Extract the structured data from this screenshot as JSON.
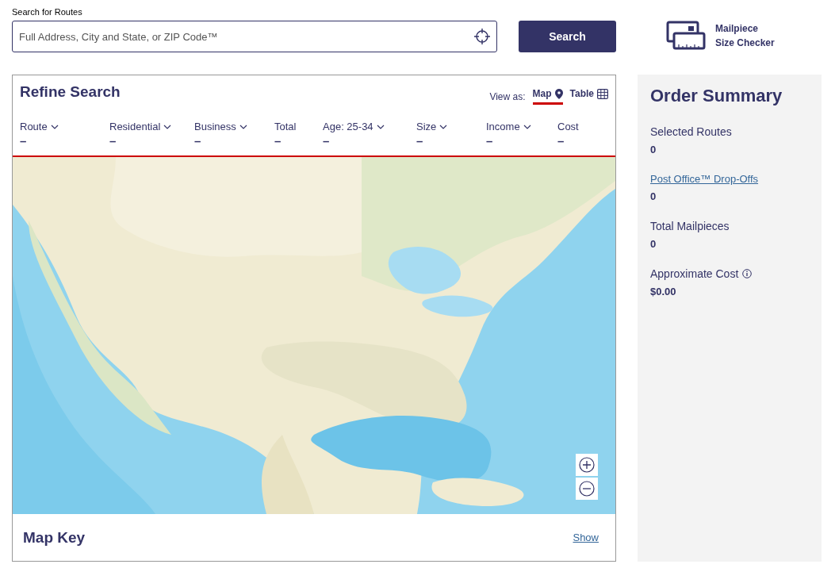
{
  "search": {
    "label": "Search for Routes",
    "placeholder": "Full Address, City and State, or ZIP Code™",
    "button": "Search"
  },
  "size_checker": {
    "line1": "Mailpiece",
    "line2": "Size Checker"
  },
  "refine": {
    "title": "Refine Search",
    "view_label": "View as:",
    "views": [
      {
        "label": "Map",
        "kind": "map",
        "selected": true
      },
      {
        "label": "Table",
        "kind": "table",
        "selected": false
      }
    ],
    "columns": [
      {
        "label": "Route",
        "dropdown": true,
        "value": "–"
      },
      {
        "label": "Residential",
        "dropdown": true,
        "value": "–"
      },
      {
        "label": "Business",
        "dropdown": true,
        "value": "–"
      },
      {
        "label": "Total",
        "dropdown": false,
        "value": "–"
      },
      {
        "label": "Age: 25-34",
        "dropdown": true,
        "value": "–"
      },
      {
        "label": "Size",
        "dropdown": true,
        "value": "–"
      },
      {
        "label": "Income",
        "dropdown": true,
        "value": "–"
      },
      {
        "label": "Cost",
        "dropdown": false,
        "value": "–"
      }
    ]
  },
  "map_key": {
    "title": "Map Key",
    "toggle": "Show"
  },
  "order_summary": {
    "title": "Order Summary",
    "items": [
      {
        "label": "Selected Routes",
        "kind": "text",
        "value": "0"
      },
      {
        "label": "Post Office™ Drop-Offs",
        "kind": "link",
        "value": "0"
      },
      {
        "label": "Total Mailpieces",
        "kind": "text",
        "value": "0"
      },
      {
        "label": "Approximate Cost",
        "kind": "info",
        "value": "$0.00"
      }
    ]
  }
}
